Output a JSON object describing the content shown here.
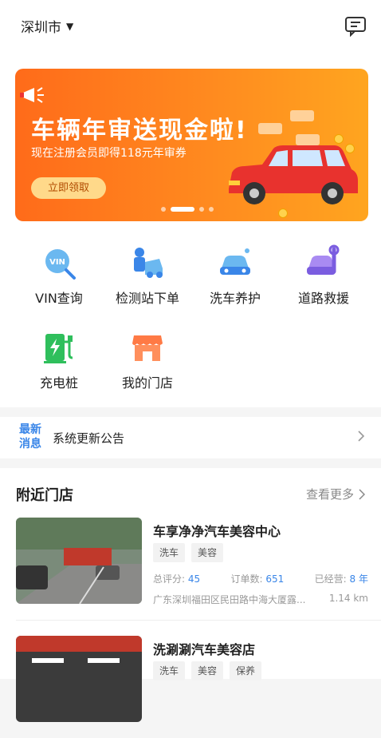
{
  "header": {
    "city": "深圳市",
    "caret": "▼",
    "message_icon": "message-icon"
  },
  "banner": {
    "title": "车辆年审送现金啦!",
    "subtitle": "现在注册会员即得118元年审券",
    "button_label": "立即领取",
    "slides": 4,
    "active_slide": 1,
    "colors": {
      "start": "#ff6b1a",
      "end": "#ffa51f"
    }
  },
  "services": [
    {
      "label": "VIN查询",
      "icon": "vin-icon"
    },
    {
      "label": "检测站下单",
      "icon": "inspection-station-icon"
    },
    {
      "label": "洗车养护",
      "icon": "car-wash-icon"
    },
    {
      "label": "道路救援",
      "icon": "road-rescue-icon"
    },
    {
      "label": "充电桩",
      "icon": "charging-pile-icon"
    },
    {
      "label": "我的门店",
      "icon": "my-store-icon"
    }
  ],
  "notice": {
    "tag_line1": "最新",
    "tag_line2": "消息",
    "text": "系统更新公告"
  },
  "nearby": {
    "title": "附近门店",
    "more_label": "查看更多",
    "stores": [
      {
        "name": "车享净净汽车美容中心",
        "tags": [
          "洗车",
          "美容"
        ],
        "rating_label": "总评分:",
        "rating": "45",
        "orders_label": "订单数:",
        "orders": "651",
        "years_label": "已经营:",
        "years": "8 年",
        "address": "广东深圳福田区民田路中海大厦露...",
        "distance": "1.14 km"
      },
      {
        "name": "洗涮涮汽车美容店",
        "tags": [
          "洗车",
          "美容",
          "保养"
        ]
      }
    ]
  },
  "accent_color": "#3a86e8"
}
